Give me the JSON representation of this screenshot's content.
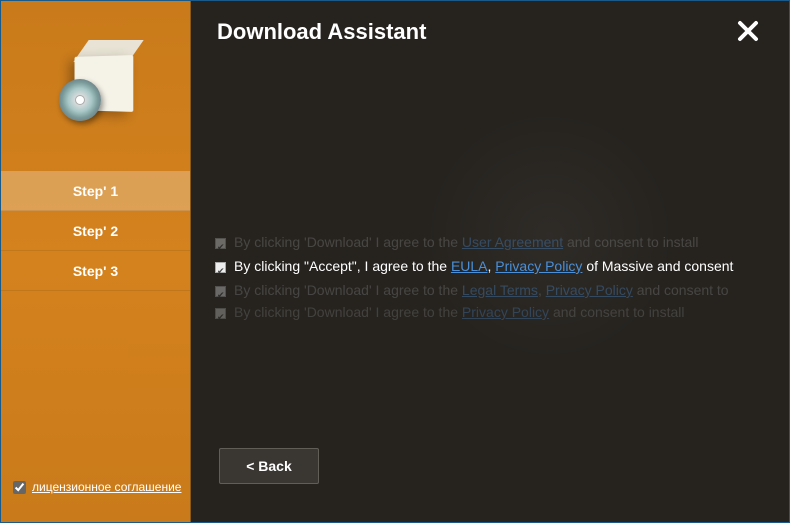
{
  "header": {
    "title": "Download Assistant"
  },
  "sidebar": {
    "steps": [
      {
        "label": "Step' 1",
        "active": true
      },
      {
        "label": "Step' 2",
        "active": false
      },
      {
        "label": "Step' 3",
        "active": false
      }
    ],
    "license_checkbox": {
      "checked": true,
      "label": "лицензионное соглашение"
    }
  },
  "consent": {
    "row0": {
      "prefix": "By clicking 'Download' I agree to the ",
      "link1": "User Agreement",
      "suffix": " and consent to install"
    },
    "row1": {
      "prefix": "By clicking \"Accept\", I agree to the ",
      "link1": "EULA",
      "sep": ", ",
      "link2": "Privacy Policy",
      "suffix": " of Massive and consent"
    },
    "row2": {
      "prefix": "By clicking 'Download' I agree to the ",
      "link1": "Legal Terms",
      "sep": ", ",
      "link2": "Privacy Policy",
      "suffix": " and consent to"
    },
    "row3": {
      "prefix": "By clicking 'Download' I agree to the ",
      "link1": "Privacy Policy",
      "suffix": " and consent to install"
    }
  },
  "buttons": {
    "back": "< Back"
  },
  "colors": {
    "sidebar": "#d17f1d",
    "main_bg": "#26231f",
    "link": "#4a8fd8",
    "border": "#1a5a8a"
  }
}
